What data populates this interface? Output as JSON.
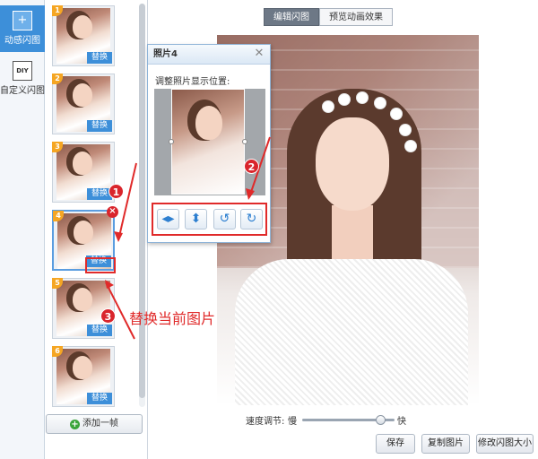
{
  "mode_bar": {
    "items": [
      {
        "label": "动感闪图",
        "icon": "plus-frame-icon"
      },
      {
        "label": "自定义闪图",
        "icon": "diy-icon",
        "icon_text": "DIY"
      }
    ]
  },
  "frames": [
    {
      "num": "1",
      "replace": "替换"
    },
    {
      "num": "2",
      "replace": "替换"
    },
    {
      "num": "3",
      "replace": "替换"
    },
    {
      "num": "4",
      "replace": "替换"
    },
    {
      "num": "5",
      "replace": "替换"
    },
    {
      "num": "6",
      "replace": "替换"
    }
  ],
  "add_frame_label": "添加一帧",
  "tabs": {
    "edit": "编辑闪图",
    "preview": "预览动画效果"
  },
  "dialog": {
    "title": "照片4",
    "hint": "调整照片显示位置:",
    "close": "✕"
  },
  "speed": {
    "label": "速度调节:",
    "slow": "慢",
    "fast": "快",
    "value_percent": 85
  },
  "buttons": {
    "save": "保存",
    "copy": "复制图片",
    "resize": "修改闪图大小"
  },
  "annotations": {
    "marker1": "1",
    "marker2": "2",
    "marker3": "3",
    "text": "替换当前图片"
  },
  "colors": {
    "accent": "#3d8fd9",
    "annotation_red": "#e02a2a",
    "badge": "#f5a623"
  }
}
